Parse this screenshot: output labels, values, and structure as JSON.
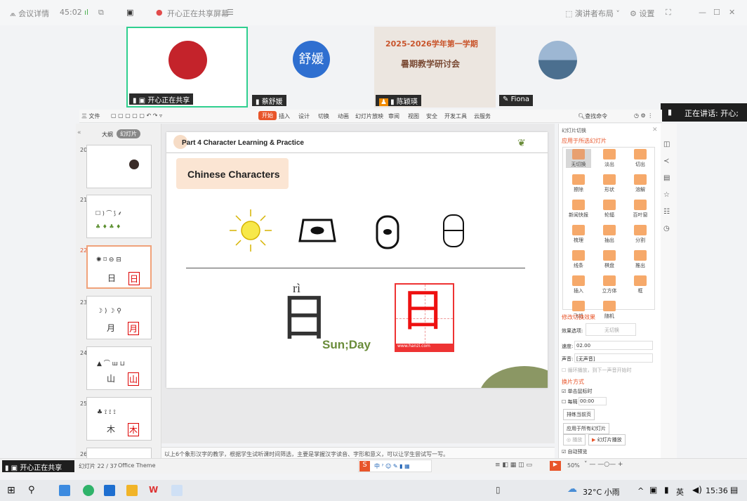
{
  "topbar": {
    "meeting_details": "会议详情",
    "timer": "45:02",
    "share_status": "开心正在共享屏幕",
    "presenter_layout": "演讲者布局",
    "settings": "设置"
  },
  "participants": [
    {
      "name": "开心正在共享"
    },
    {
      "name": "蔡舒媛",
      "avatar_text": "舒媛"
    },
    {
      "name": "陈颖瑛",
      "slide_line1": "2025-2026学年第一学期",
      "slide_line2": "暑期教学研讨会"
    },
    {
      "name": "Fiona"
    }
  ],
  "speaking": {
    "label": "正在讲话: 开心;"
  },
  "ribbon": {
    "file": "三 文件",
    "tabs": [
      "开始",
      "插入",
      "设计",
      "切换",
      "动画",
      "幻灯片放映",
      "审阅",
      "视图",
      "安全",
      "开发工具",
      "云服务"
    ],
    "search": "查找命令"
  },
  "thumbs": {
    "outline_tab": "大纲",
    "slides_tab": "幻灯片",
    "items": [
      {
        "num": "20"
      },
      {
        "num": "21"
      },
      {
        "num": "22",
        "char": "日"
      },
      {
        "num": "23",
        "char": "月"
      },
      {
        "num": "24",
        "char": "山"
      },
      {
        "num": "25",
        "char": "木"
      },
      {
        "num": "26"
      }
    ]
  },
  "slide": {
    "header": "Part 4 Character Learning & Practice",
    "badge": "Chinese Characters",
    "pinyin": "rì",
    "hanzi": "日",
    "meaning": "Sun;Day",
    "watermark": "www.hanzi.com"
  },
  "panel": {
    "title": "幻灯片切换",
    "apply_label": "应用于所选幻灯片",
    "transitions": [
      "无切换",
      "淡出",
      "切出",
      "擦除",
      "形状",
      "溶解",
      "新闻快报",
      "轮辐",
      "百叶窗",
      "梳理",
      "抽出",
      "分割",
      "线条",
      "棋盘",
      "推出",
      "插入",
      "立方体",
      "框",
      "飞机",
      "随机"
    ],
    "modify": "修改切换效果",
    "effect_label": "效果选项:",
    "effect_value": "无切换",
    "speed_label": "速度:",
    "speed_value": "02.00",
    "sound_label": "声音:",
    "sound_value": "[无声音]",
    "loop": "循环播放，到下一声音开始时",
    "advance": "换片方式",
    "on_click": "单击鼠标时",
    "every": "每隔",
    "every_value": "00:00",
    "rehearse": "排练当前页",
    "apply_all": "应用于所有幻灯片",
    "play": "播放",
    "slideshow": "幻灯片播放",
    "autopreview": "自动预览"
  },
  "notes": "以上6个象形汉字的教学，根据学生试听课时间筛选，主要是掌握汉字读音、字形和意义，可以让学生尝试写一写。",
  "status": {
    "sharing": "开心正在共享",
    "slide_count": "幻灯片 22 / 37",
    "theme": "Office Theme",
    "zoom": "50%"
  },
  "taskbar": {
    "weather": "32°C 小雨",
    "lang": "英",
    "time": "15:36"
  }
}
